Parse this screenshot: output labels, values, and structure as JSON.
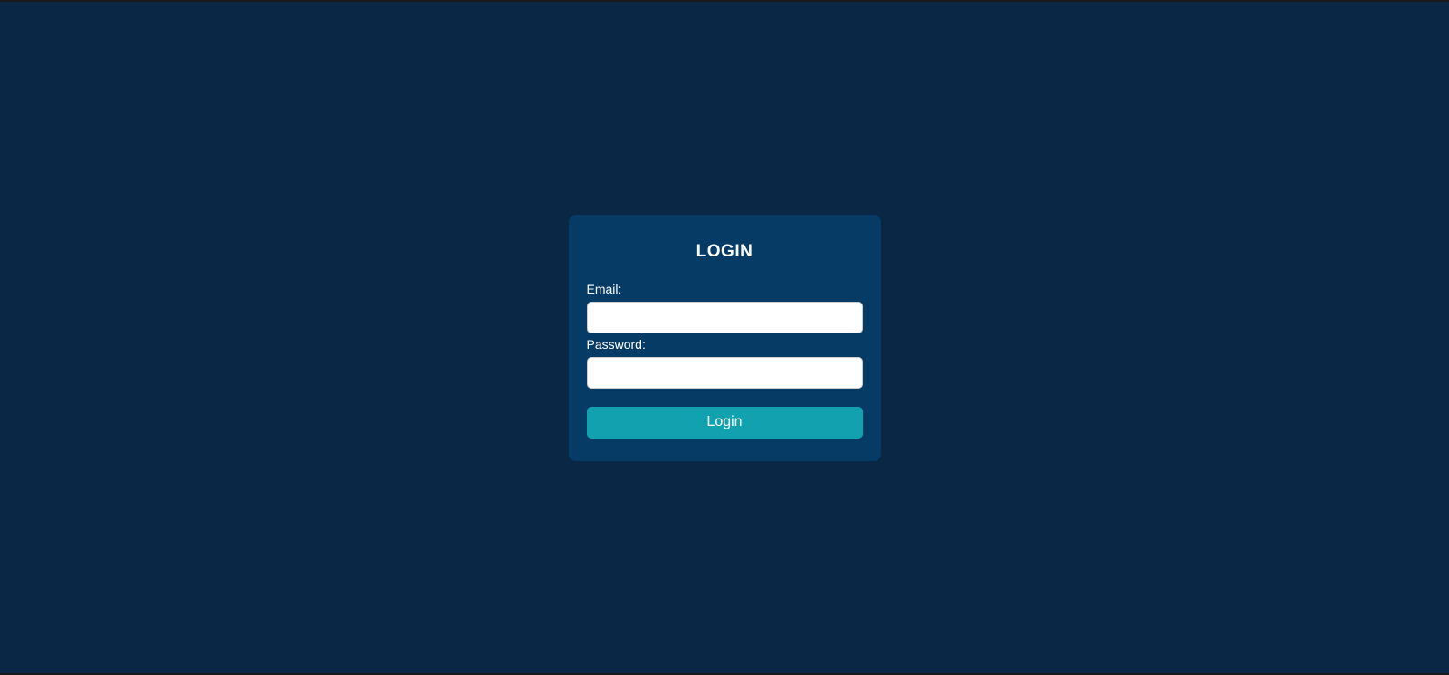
{
  "login": {
    "title": "LOGIN",
    "email_label": "Email:",
    "email_value": "",
    "password_label": "Password:",
    "password_value": "",
    "button_label": "Login"
  },
  "colors": {
    "page_background": "#0a2745",
    "card_background": "#063b66",
    "button_background": "#12a2af",
    "text": "#ffffff"
  }
}
